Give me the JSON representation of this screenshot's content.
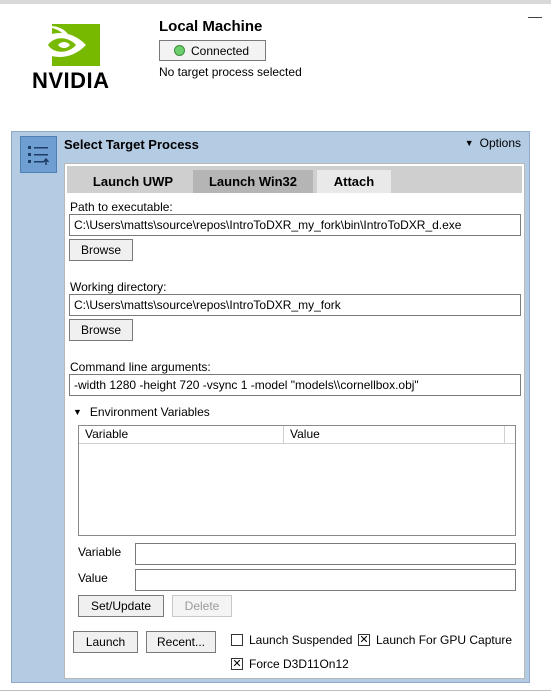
{
  "header": {
    "logo_text": "NVIDIA",
    "machine_title": "Local Machine",
    "connection_status": "Connected",
    "target_status": "No target process selected",
    "minimize_symbol": "—"
  },
  "panel": {
    "title": "Select Target Process",
    "options_label": "Options",
    "tabs": [
      {
        "label": "Launch UWP"
      },
      {
        "label": "Launch Win32"
      },
      {
        "label": "Attach"
      }
    ],
    "path_label": "Path to executable:",
    "path_value": "C:\\Users\\matts\\source\\repos\\IntroToDXR_my_fork\\bin\\IntroToDXR_d.exe",
    "browse_label": "Browse",
    "workdir_label": "Working directory:",
    "workdir_value": "C:\\Users\\matts\\source\\repos\\IntroToDXR_my_fork",
    "args_label": "Command line arguments:",
    "args_value": "-width 1280 -height 720 -vsync 1 -model \"models\\\\cornellbox.obj\"",
    "env": {
      "toggle_label": "Environment Variables",
      "columns": [
        "Variable",
        "Value"
      ],
      "variable_label": "Variable",
      "value_label": "Value",
      "variable_value": "",
      "value_value": "",
      "set_update_label": "Set/Update",
      "delete_label": "Delete"
    },
    "launch_label": "Launch",
    "recent_label": "Recent...",
    "checkboxes": [
      {
        "label": "Launch Suspended",
        "checked": false
      },
      {
        "label": "Launch For GPU Capture",
        "checked": true
      },
      {
        "label": "Force D3D11On12",
        "checked": true
      }
    ]
  },
  "colors": {
    "brand_green": "#76b900",
    "panel_bg": "#b4cbe4",
    "status_green": "#6ccf6c"
  },
  "icons": [
    "nvidia-logo",
    "connected-status-icon",
    "target-process-icon",
    "options-dropdown-icon",
    "expand-arrow-icon",
    "checkbox-icon"
  ]
}
